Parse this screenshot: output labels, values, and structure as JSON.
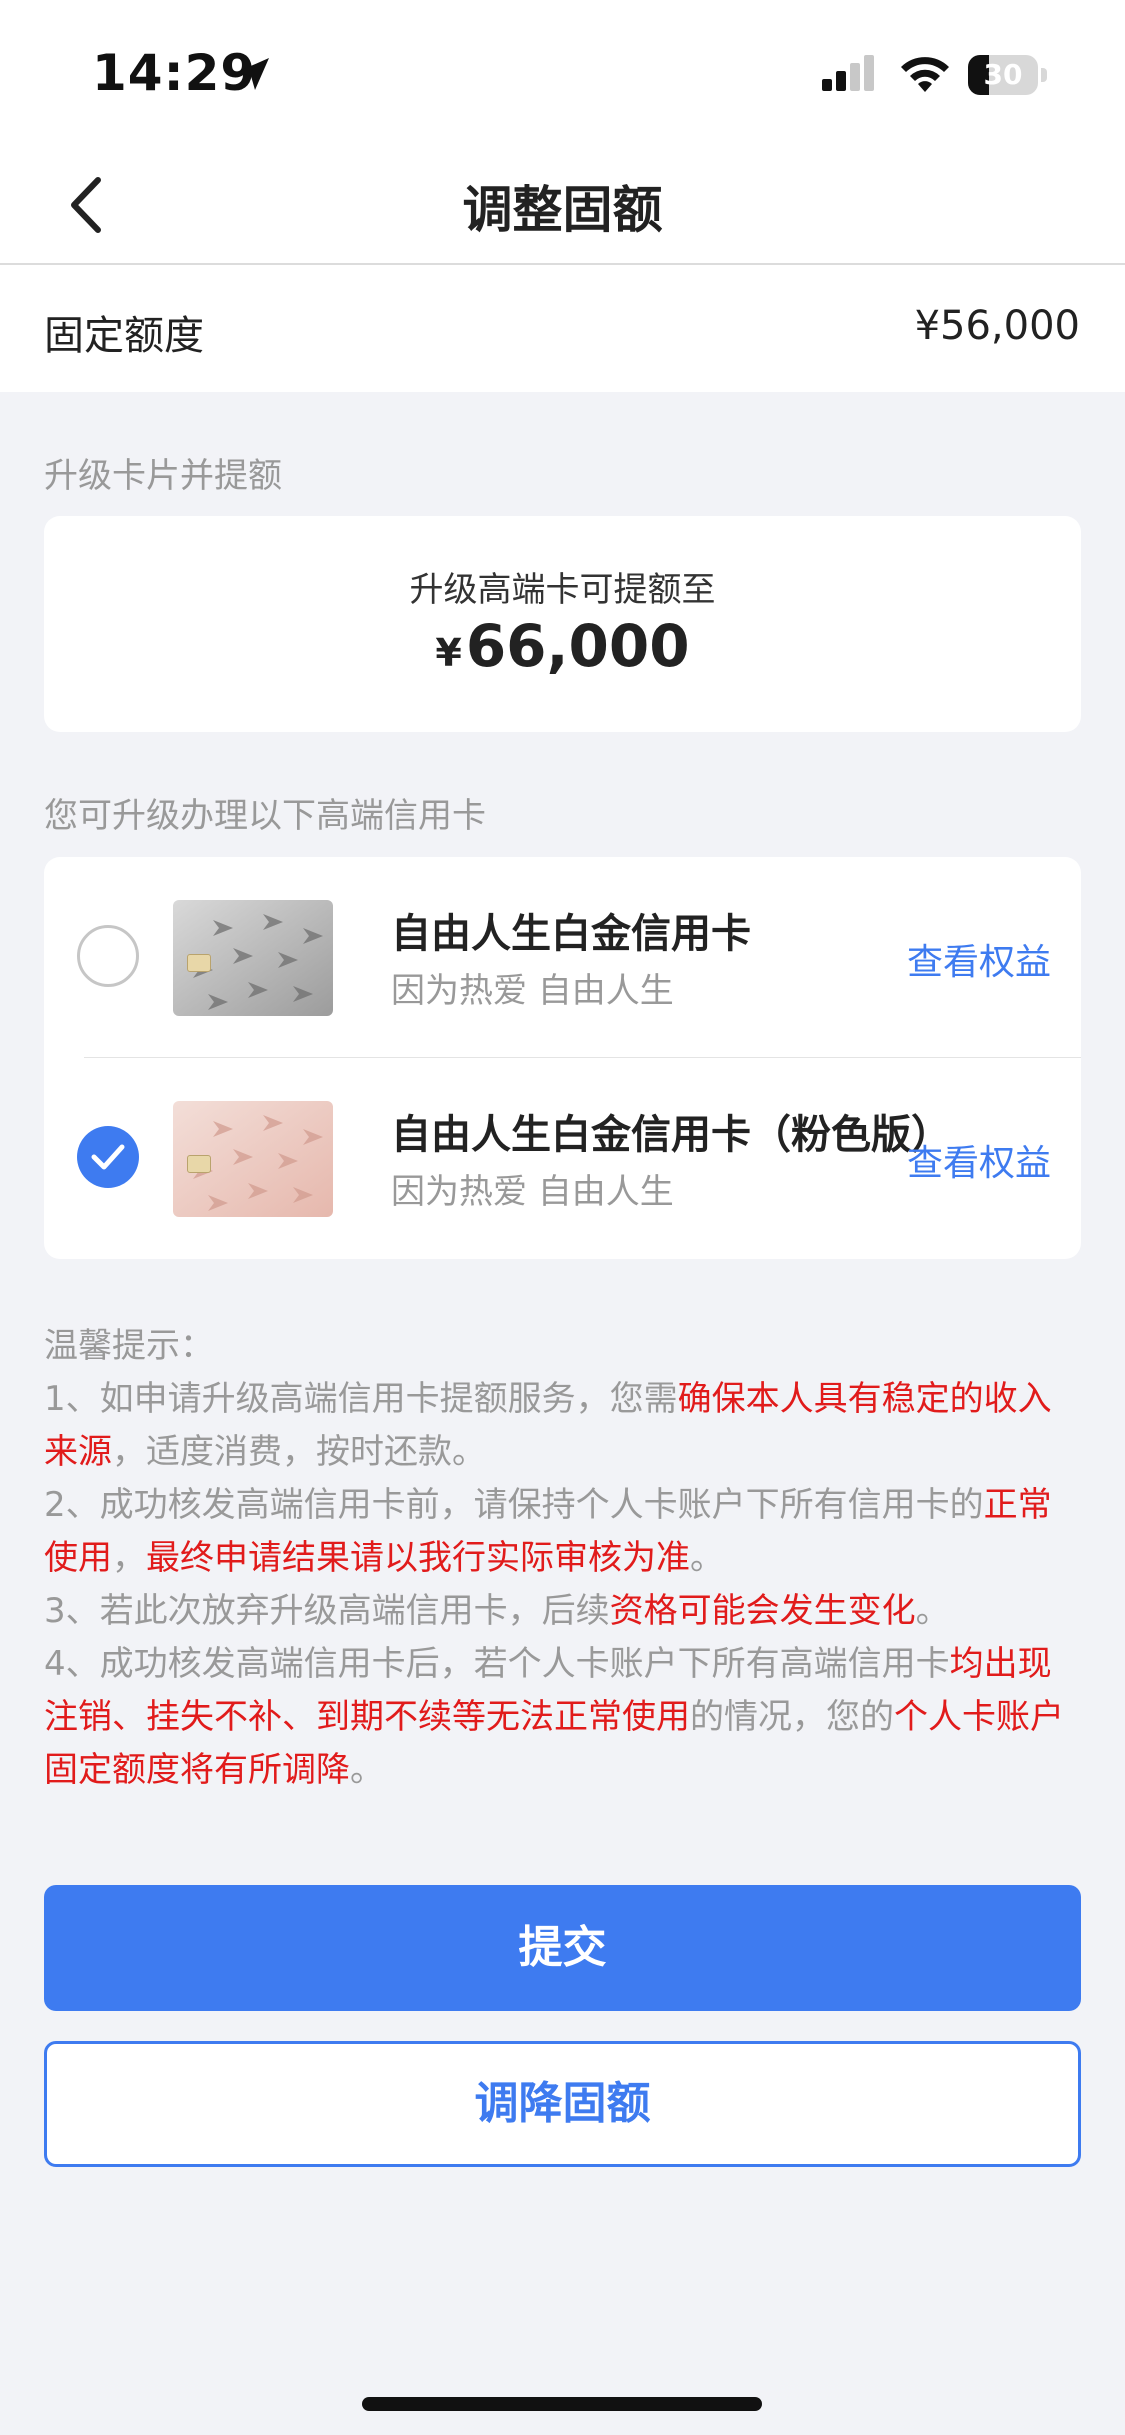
{
  "status_bar": {
    "time": "14:29",
    "battery": "30",
    "battery_level_pct": 30
  },
  "nav": {
    "title": "调整固额",
    "back_icon": "chevron-left-icon"
  },
  "fixed_limit": {
    "label": "固定额度",
    "value": "¥56,000"
  },
  "upgrade_section": {
    "title": "升级卡片并提额",
    "limit_label": "升级高端卡可提额至",
    "limit_currency": "¥",
    "limit_amount": "66,000"
  },
  "cards_section": {
    "title": "您可升级办理以下高端信用卡",
    "options": [
      {
        "name": "自由人生白金信用卡",
        "subtitle": "因为热爱 自由人生",
        "benefit_link": "查看权益",
        "selected": false,
        "card_color": "silver"
      },
      {
        "name": "自由人生白金信用卡（粉色版）",
        "subtitle": "因为热爱 自由人生",
        "benefit_link": "查看权益",
        "selected": true,
        "card_color": "pink"
      }
    ]
  },
  "tips": {
    "heading": "温馨提示：",
    "items": [
      [
        {
          "t": "1、如申请升级高端信用卡提额服务，您需",
          "hl": false
        },
        {
          "t": "确保本人具有稳定的收入来源",
          "hl": true
        },
        {
          "t": "，适度消费，按时还款。",
          "hl": false
        }
      ],
      [
        {
          "t": "2、成功核发高端信用卡前，请保持个人卡账户下所有信用卡的",
          "hl": false
        },
        {
          "t": "正常使用",
          "hl": true
        },
        {
          "t": "，",
          "hl": false
        },
        {
          "t": "最终申请结果请以我行实际审核为准",
          "hl": true
        },
        {
          "t": "。",
          "hl": false
        }
      ],
      [
        {
          "t": "3、若此次放弃升级高端信用卡，后续",
          "hl": false
        },
        {
          "t": "资格可能会发生变化",
          "hl": true
        },
        {
          "t": "。",
          "hl": false
        }
      ],
      [
        {
          "t": "4、成功核发高端信用卡后，若个人卡账户下所有高端信用卡",
          "hl": false
        },
        {
          "t": "均出现注销、挂失不补、到期不续等无法正常使用",
          "hl": true
        },
        {
          "t": "的情况，您的",
          "hl": false
        },
        {
          "t": "个人卡账户固定额度将有所调降",
          "hl": true
        },
        {
          "t": "。",
          "hl": false
        }
      ]
    ]
  },
  "buttons": {
    "submit": "提交",
    "reduce": "调降固额"
  },
  "colors": {
    "accent": "#3e7bf0",
    "highlight": "#e11b1b",
    "muted": "#999999"
  }
}
